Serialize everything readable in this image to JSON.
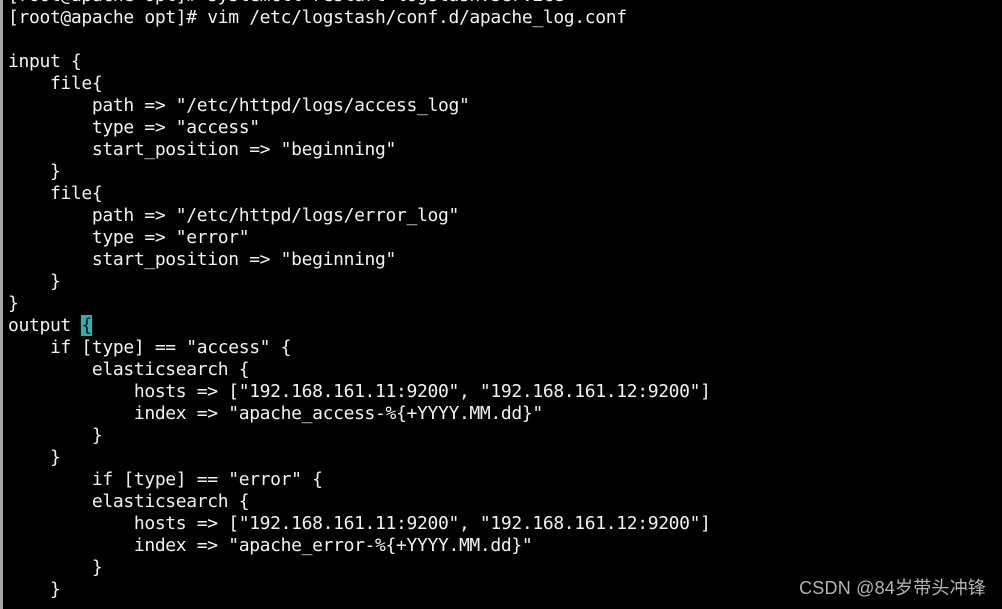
{
  "terminal": {
    "lines": [
      "[root@apache opt]# systemctl restart logstash.service",
      "[root@apache opt]# vim /etc/logstash/conf.d/apache_log.conf",
      "",
      "input {",
      "    file{",
      "        path => \"/etc/httpd/logs/access_log\"",
      "        type => \"access\"",
      "        start_position => \"beginning\"",
      "    }",
      "    file{",
      "        path => \"/etc/httpd/logs/error_log\"",
      "        type => \"error\"",
      "        start_position => \"beginning\"",
      "    }",
      "}",
      "output ",
      "    if [type] == \"access\" {",
      "        elasticsearch {",
      "            hosts => [\"192.168.161.11:9200\", \"192.168.161.12:9200\"]",
      "            index => \"apache_access-%{+YYYY.MM.dd}\"",
      "        }",
      "    }",
      "        if [type] == \"error\" {",
      "        elasticsearch {",
      "            hosts => [\"192.168.161.11:9200\", \"192.168.161.12:9200\"]",
      "            index => \"apache_error-%{+YYYY.MM.dd}\"",
      "        }",
      "    }"
    ],
    "cursor_char": "{",
    "cursor_line_index": 15,
    "colors": {
      "background": "#000000",
      "foreground": "#f2f2f2",
      "cursor": "#1fb5b5"
    }
  },
  "watermark": "CSDN @84岁带头冲锋"
}
